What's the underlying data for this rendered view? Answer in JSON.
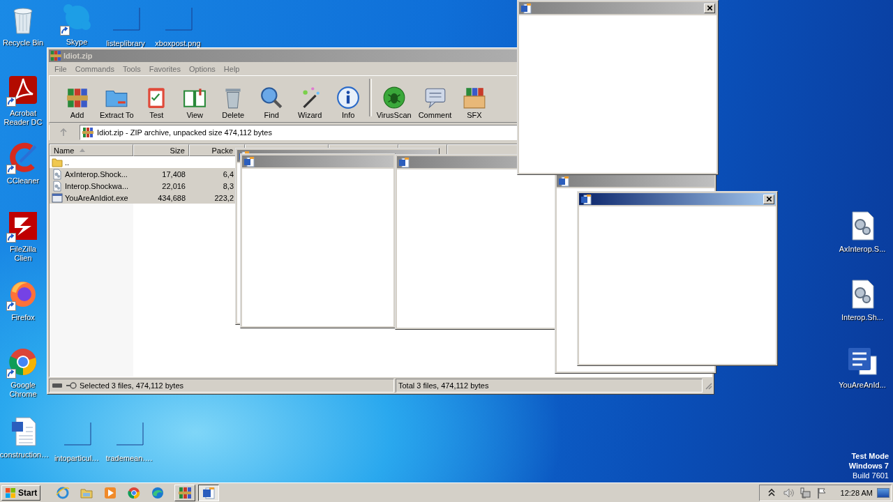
{
  "desktop_icons": [
    {
      "label": "Recycle Bin",
      "kind": "bin",
      "shortcut": false
    },
    {
      "label": "Skype",
      "kind": "chat",
      "shortcut": true
    },
    {
      "label": "listeplibrary",
      "kind": "blank",
      "shortcut": false
    },
    {
      "label": "xboxpost.png",
      "kind": "blank",
      "shortcut": false
    },
    {
      "label": "Acrobat Reader DC",
      "kind": "pdf",
      "shortcut": true
    },
    {
      "label": "CCleaner",
      "kind": "cleaner",
      "shortcut": true
    },
    {
      "label": "FileZilla Clien",
      "kind": "ftp",
      "shortcut": true
    },
    {
      "label": "Firefox",
      "kind": "fox",
      "shortcut": true
    },
    {
      "label": "Google Chrome",
      "kind": "chrome",
      "shortcut": true
    },
    {
      "label": "construction…",
      "kind": "worddoc",
      "shortcut": false
    },
    {
      "label": "intoparticul…",
      "kind": "blank",
      "shortcut": false
    },
    {
      "label": "trademean….",
      "kind": "blank",
      "shortcut": false
    },
    {
      "label": "AxInterop.S...",
      "kind": "gearfile",
      "shortcut": false
    },
    {
      "label": "Interop.Sh...",
      "kind": "gearfile",
      "shortcut": false
    },
    {
      "label": "YouAreAnId...",
      "kind": "wordapp",
      "shortcut": false
    }
  ],
  "archive_window": {
    "title": "Idiot.zip",
    "active": false,
    "menu": [
      "File",
      "Commands",
      "Tools",
      "Favorites",
      "Options",
      "Help"
    ],
    "toolbar_groups": [
      {
        "buttons": [
          {
            "label": "Add",
            "kind": "add"
          },
          {
            "label": "Extract To",
            "kind": "extract"
          },
          {
            "label": "Test",
            "kind": "test"
          },
          {
            "label": "View",
            "kind": "view"
          },
          {
            "label": "Delete",
            "kind": "delete"
          },
          {
            "label": "Find",
            "kind": "find"
          },
          {
            "label": "Wizard",
            "kind": "wizard"
          },
          {
            "label": "Info",
            "kind": "info"
          }
        ]
      },
      {
        "buttons": [
          {
            "label": "VirusScan",
            "kind": "virus"
          },
          {
            "label": "Comment",
            "kind": "comment"
          },
          {
            "label": "SFX",
            "kind": "sfx"
          }
        ]
      }
    ],
    "address": "Idiot.zip - ZIP archive, unpacked size 474,112 bytes",
    "columns": [
      {
        "label": "Name",
        "sorted": true
      },
      {
        "label": "Size",
        "sorted": false
      },
      {
        "label": "Packe",
        "sorted": false
      }
    ],
    "rows": [
      {
        "name": "..",
        "kind": "folder",
        "selected": false
      },
      {
        "name": "AxInterop.Shock...",
        "size": "17,408",
        "packed": "6,4",
        "kind": "file",
        "selected": true
      },
      {
        "name": "Interop.Shockwa...",
        "size": "22,016",
        "packed": "8,3",
        "kind": "file",
        "selected": true
      },
      {
        "name": "YouAreAnIdiot.exe",
        "size": "434,688",
        "packed": "223,2",
        "kind": "exe",
        "selected": true
      }
    ],
    "status_left": "Selected 3 files, 474,112 bytes",
    "status_right": "Total 3 files, 474,112 bytes"
  },
  "popup_windows": [
    {
      "active": false,
      "close_button": false
    },
    {
      "active": false,
      "close_button": false
    },
    {
      "active": false,
      "close_button": false
    },
    {
      "active": false,
      "close_button": false
    },
    {
      "active": false,
      "close_button": true
    },
    {
      "active": true,
      "close_button": true
    }
  ],
  "system_notice": [
    "Test Mode",
    "Windows 7",
    "Build 7601"
  ],
  "taskbar": {
    "start": "Start",
    "quick_launch": [
      {
        "kind": "ie"
      },
      {
        "kind": "folder"
      },
      {
        "kind": "media"
      },
      {
        "kind": "chrome"
      },
      {
        "kind": "edge"
      }
    ],
    "tasks": [
      {
        "kind": "archive",
        "active": false
      },
      {
        "kind": "word",
        "active": true
      }
    ],
    "tray": [
      {
        "kind": "chevron"
      },
      {
        "kind": "speaker"
      },
      {
        "kind": "network"
      },
      {
        "kind": "flag"
      }
    ],
    "clock": "12:28 AM"
  }
}
